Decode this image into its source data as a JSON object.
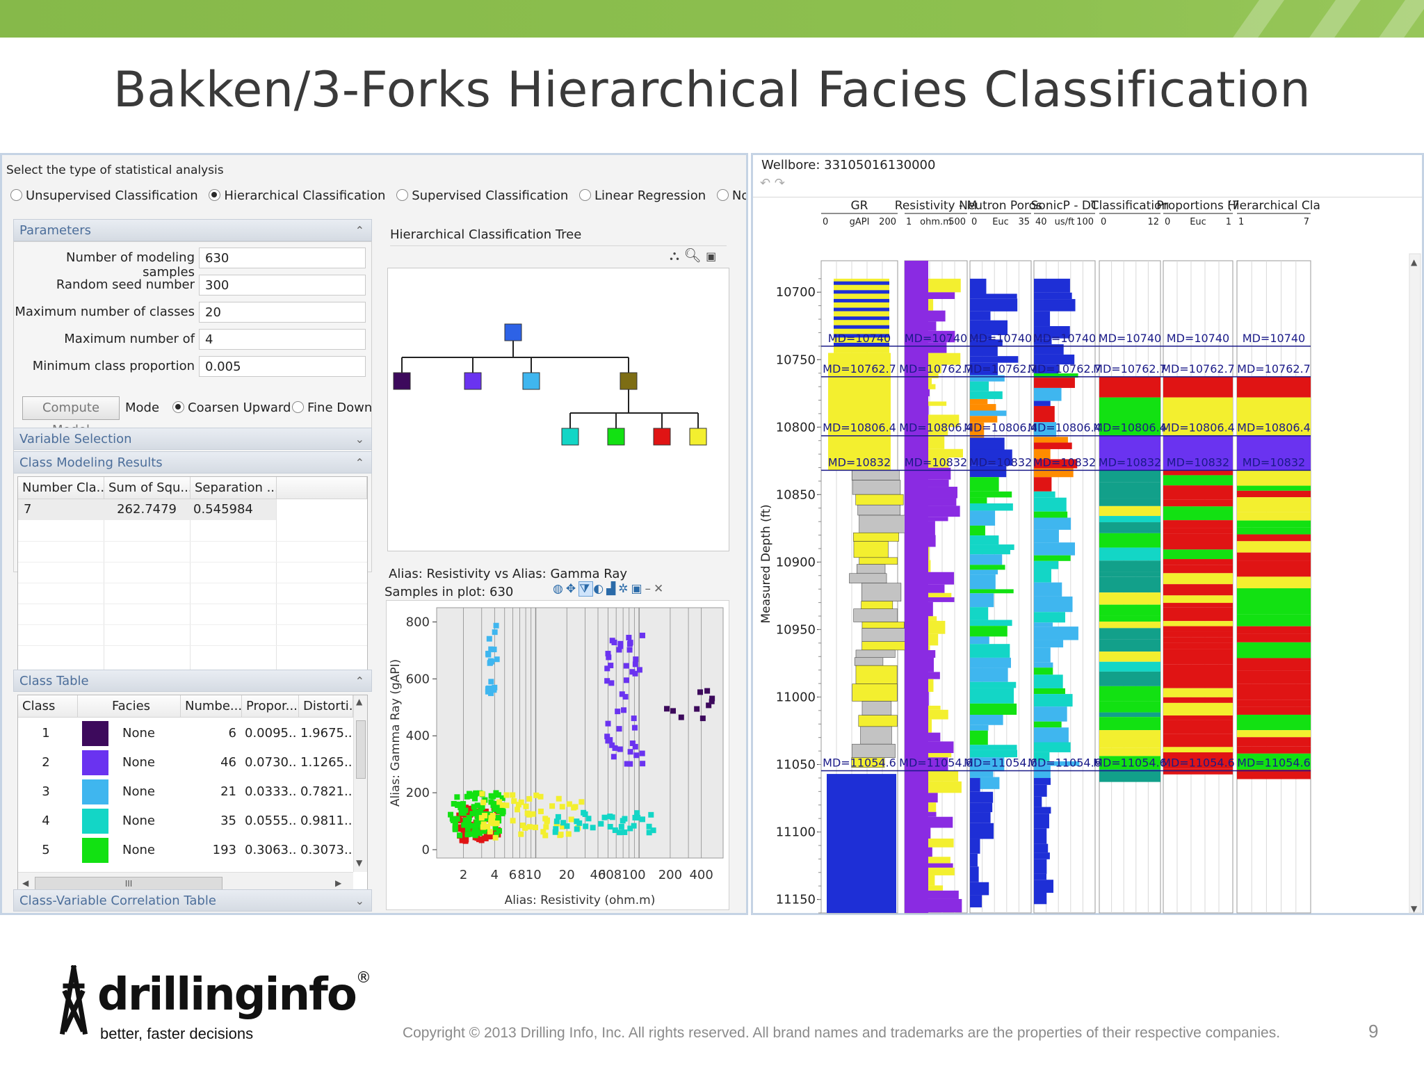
{
  "slide": {
    "title": "Bakken/3-Forks Hierarchical Facies Classification",
    "copyright": "Copyright © 2013 Drilling Info, Inc. All rights reserved. All brand names and trademarks are the properties of their respective companies.",
    "page_number": "9",
    "logo_text": "drillinginfo",
    "logo_registered": "®",
    "tagline": "better, faster decisions",
    "brand_green": "#8dc04f"
  },
  "analysis": {
    "prompt": "Select the type of statistical analysis",
    "types": [
      {
        "label": "Unsupervised Classification",
        "selected": false
      },
      {
        "label": "Hierarchical Classification",
        "selected": true
      },
      {
        "label": "Supervised Classification",
        "selected": false
      },
      {
        "label": "Linear Regression",
        "selected": false
      },
      {
        "label": "Non-Linear Re",
        "selected": false
      }
    ]
  },
  "parameters": {
    "header": "Parameters",
    "fields": [
      {
        "label": "Number of modeling samples",
        "value": "630"
      },
      {
        "label": "Random seed number",
        "value": "300"
      },
      {
        "label": "Maximum number of classes",
        "value": "20"
      },
      {
        "label": "Maximum number of",
        "value": "4"
      },
      {
        "label": "Minimum class proportion",
        "value": "0.005"
      }
    ],
    "compute_button": "Compute Model",
    "mode_label": "Mode",
    "mode_options": [
      {
        "label": "Coarsen Upward",
        "selected": true
      },
      {
        "label": "Fine Down",
        "selected": false
      }
    ]
  },
  "sections": {
    "variable_selection": "Variable Selection",
    "class_modeling_results": "Class Modeling Results",
    "class_table": "Class Table",
    "correlation_table": "Class-Variable Correlation Table"
  },
  "results_table": {
    "headers": [
      "Number Cla...",
      "Sum of Squ...",
      "Separation ..."
    ],
    "rows": [
      [
        "7",
        "262.7479",
        "0.545984"
      ]
    ]
  },
  "class_table": {
    "headers": [
      "Class",
      "Facies",
      "Numbe...",
      "Propor...",
      "Distorti..."
    ],
    "rows": [
      {
        "cls": "1",
        "color": "#3d0a5c",
        "facies": "None",
        "number": "6",
        "proportion": "0.0095...",
        "distortion": "1.9675..."
      },
      {
        "cls": "2",
        "color": "#6a33f0",
        "facies": "None",
        "number": "46",
        "proportion": "0.0730...",
        "distortion": "1.1265..."
      },
      {
        "cls": "3",
        "color": "#3fb6ef",
        "facies": "None",
        "number": "21",
        "proportion": "0.0333...",
        "distortion": "0.7821..."
      },
      {
        "cls": "4",
        "color": "#13d6c6",
        "facies": "None",
        "number": "35",
        "proportion": "0.0555...",
        "distortion": "0.9811..."
      },
      {
        "cls": "5",
        "color": "#12e112",
        "facies": "None",
        "number": "193",
        "proportion": "0.3063...",
        "distortion": "0.3073..."
      }
    ],
    "scroll_glyph": "III"
  },
  "tree": {
    "title": "Hierarchical Classification Tree",
    "node_colors": {
      "root": "#2d62e6",
      "level1": [
        "#3d0a5c",
        "#6a33f0",
        "#3fb6ef",
        "#7d6d14"
      ],
      "level2": [
        "#13d6c6",
        "#12e112",
        "#e01414",
        "#f3ef2f"
      ]
    }
  },
  "crossplot": {
    "title": "Alias: Resistivity vs Alias: Gamma Ray",
    "samples": "Samples in plot: 630",
    "xlabel": "Alias: Resistivity (ohm.m)",
    "ylabel": "Alias: Gamma Ray (gAPI)",
    "x_ticks": [
      "2",
      "4",
      "6",
      "810",
      "20",
      "40",
      "608100",
      "200",
      "400"
    ],
    "y_ticks": [
      "800",
      "600",
      "400",
      "200",
      "0"
    ]
  },
  "well_log": {
    "wellbore": "Wellbore: 33105016130000",
    "depth_label": "Measured Depth (ft)",
    "depth_ticks": [
      "10700",
      "10750",
      "10800",
      "10850",
      "10900",
      "10950",
      "11000",
      "11050",
      "11100",
      "11150"
    ],
    "tracks": [
      {
        "name": "GR",
        "unit": "gAPI",
        "min": "0",
        "max": "200"
      },
      {
        "name": "Resistivity - M",
        "unit": "ohm.m",
        "min": "1",
        "max": "500"
      },
      {
        "name": "Neutron Poros",
        "unit": "Euc",
        "min": "0",
        "max": "35"
      },
      {
        "name": "SonicP - DT",
        "unit": "us/ft",
        "min": "40",
        "max": "100"
      },
      {
        "name": "Classification",
        "unit": "",
        "min": "0",
        "max": "12"
      },
      {
        "name": "Proportions (7",
        "unit": "Euc",
        "min": "0",
        "max": "1"
      },
      {
        "name": "Hierarchical Cla",
        "unit": "",
        "min": "1",
        "max": "7"
      }
    ],
    "markers": [
      {
        "label": "MD=10740",
        "depth": 10740
      },
      {
        "label": "MD=10762.7",
        "depth": 10762.7
      },
      {
        "label": "MD=10806.4",
        "depth": 10806.4
      },
      {
        "label": "MD=10832",
        "depth": 10832
      },
      {
        "label": "MD=11054.6",
        "depth": 11054.6
      }
    ]
  }
}
